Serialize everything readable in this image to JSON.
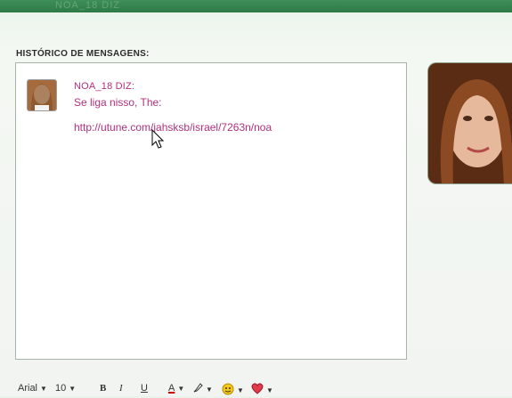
{
  "header": {
    "title": "NOA_18 DIZ"
  },
  "history": {
    "label": "HISTÓRICO DE MENSAGENS:",
    "messages": [
      {
        "sender": "NOA_18 DIZ:",
        "text": "Se liga nisso, The:",
        "link": "http://utune.com/jahsksb/israel/7263n/noa"
      }
    ]
  },
  "toolbar": {
    "font": "Arial",
    "size": "10",
    "bold": "B",
    "italic": "I",
    "underline": "U",
    "font_color": "A"
  },
  "icons": {
    "bold": "bold-icon",
    "italic": "italic-icon",
    "underline": "underline-icon",
    "font_color": "font-color-icon",
    "highlight": "highlight-pen-icon",
    "emoticon": "smiley-icon",
    "wink": "heart-icon"
  },
  "colors": {
    "header_green": "#2d7a47",
    "message_magenta": "#b0307d",
    "background": "#f1f4f1"
  }
}
